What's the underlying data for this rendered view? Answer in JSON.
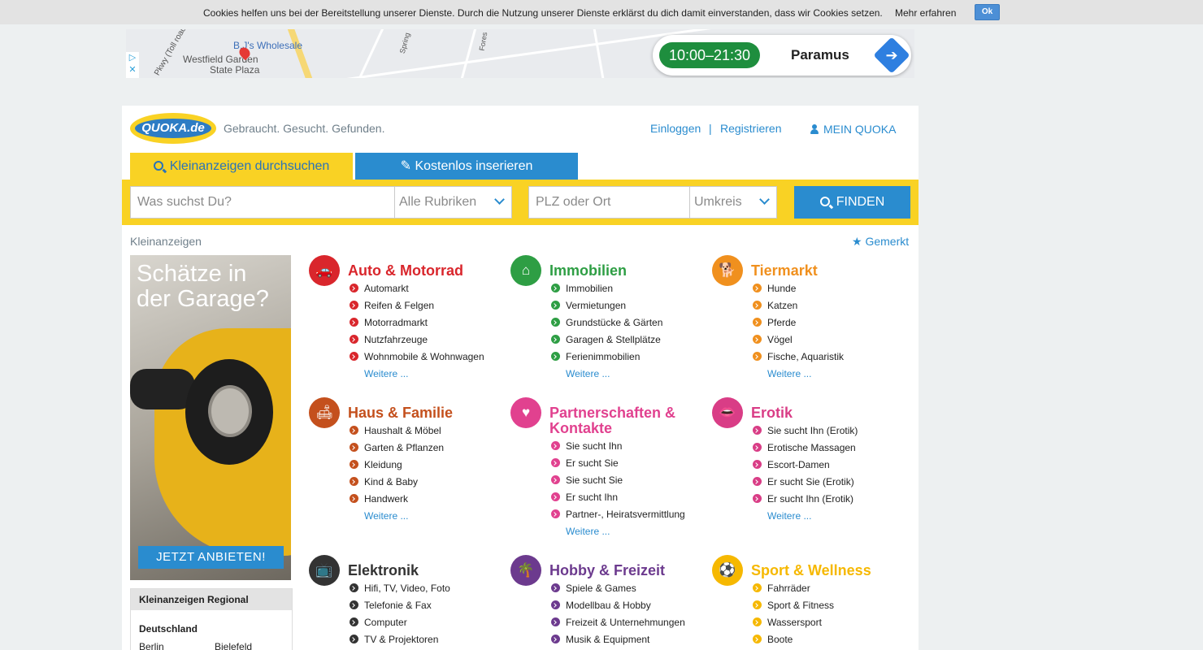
{
  "cookie": {
    "message": "Cookies helfen uns bei der Bereitstellung unserer Dienste. Durch die Nutzung unserer Dienste erklärst du dich damit einverstanden, dass wir Cookies setzen.",
    "more_label": "Mehr erfahren",
    "ok_label": "Ok"
  },
  "map_ad": {
    "labels": [
      "B.J's Wholesale",
      "Westfield Garden",
      "State Plaza",
      "Pkwy (Toll road)",
      "Spring",
      "Fores"
    ],
    "hours": "10:00–21:30",
    "city": "Paramus"
  },
  "header": {
    "logo_text": "QUOKA.de",
    "slogan": "Gebraucht. Gesucht. Gefunden.",
    "login": "Einloggen",
    "separator": "|",
    "register": "Registrieren",
    "my_account": "MEIN QUOKA"
  },
  "tabs": {
    "search": "Kleinanzeigen durchsuchen",
    "post": "Kostenlos inserieren"
  },
  "search": {
    "query_placeholder": "Was suchst Du?",
    "category_value": "Alle Rubriken",
    "location_placeholder": "PLZ oder Ort",
    "radius_value": "Umkreis",
    "find_label": "FINDEN"
  },
  "breadcrumb": "Kleinanzeigen",
  "bookmarked": "Gemerkt",
  "ad_banner": {
    "headline_line1": "Schätze in",
    "headline_line2": "der Garage?",
    "cta": "JETZT ANBIETEN!"
  },
  "regional": {
    "title": "Kleinanzeigen Regional",
    "country": "Deutschland",
    "cities": [
      "Berlin",
      "Bielefeld"
    ]
  },
  "more_label": "Weitere ...",
  "categories": [
    {
      "title": "Auto & Motorrad",
      "color": "#d9262c",
      "icon": "car-icon",
      "items": [
        "Automarkt",
        "Reifen & Felgen",
        "Motorradmarkt",
        "Nutzfahrzeuge",
        "Wohnmobile & Wohnwagen"
      ]
    },
    {
      "title": "Immobilien",
      "color": "#2e9e44",
      "icon": "house-icon",
      "items": [
        "Immobilien",
        "Vermietungen",
        "Grundstücke & Gärten",
        "Garagen & Stellplätze",
        "Ferienimmobilien"
      ]
    },
    {
      "title": "Tiermarkt",
      "color": "#f0901e",
      "icon": "dog-icon",
      "items": [
        "Hunde",
        "Katzen",
        "Pferde",
        "Vögel",
        "Fische, Aquaristik"
      ]
    },
    {
      "title": "Haus & Familie",
      "color": "#c4501d",
      "icon": "sofa-icon",
      "items": [
        "Haushalt & Möbel",
        "Garten & Pflanzen",
        "Kleidung",
        "Kind & Baby",
        "Handwerk"
      ]
    },
    {
      "title": "Partnerschaften & Kontakte",
      "color": "#e1418f",
      "icon": "hearts-icon",
      "items": [
        "Sie sucht Ihn",
        "Er sucht Sie",
        "Sie sucht Sie",
        "Er sucht Ihn",
        "Partner-, Heiratsvermittlung"
      ]
    },
    {
      "title": "Erotik",
      "color": "#d93d86",
      "icon": "lips-icon",
      "items": [
        "Sie sucht Ihn (Erotik)",
        "Erotische Massagen",
        "Escort-Damen",
        "Er sucht Sie (Erotik)",
        "Er sucht Ihn (Erotik)"
      ]
    },
    {
      "title": "Elektronik",
      "color": "#333333",
      "icon": "tv-icon",
      "items": [
        "Hifi, TV, Video, Foto",
        "Telefonie & Fax",
        "Computer",
        "TV & Projektoren"
      ]
    },
    {
      "title": "Hobby & Freizeit",
      "color": "#6c3a8e",
      "icon": "palm-icon",
      "items": [
        "Spiele & Games",
        "Modellbau & Hobby",
        "Freizeit & Unternehmungen",
        "Musik & Equipment"
      ]
    },
    {
      "title": "Sport & Wellness",
      "color": "#f6b800",
      "icon": "sport-icon",
      "items": [
        "Fahrräder",
        "Sport & Fitness",
        "Wassersport",
        "Boote"
      ]
    }
  ]
}
